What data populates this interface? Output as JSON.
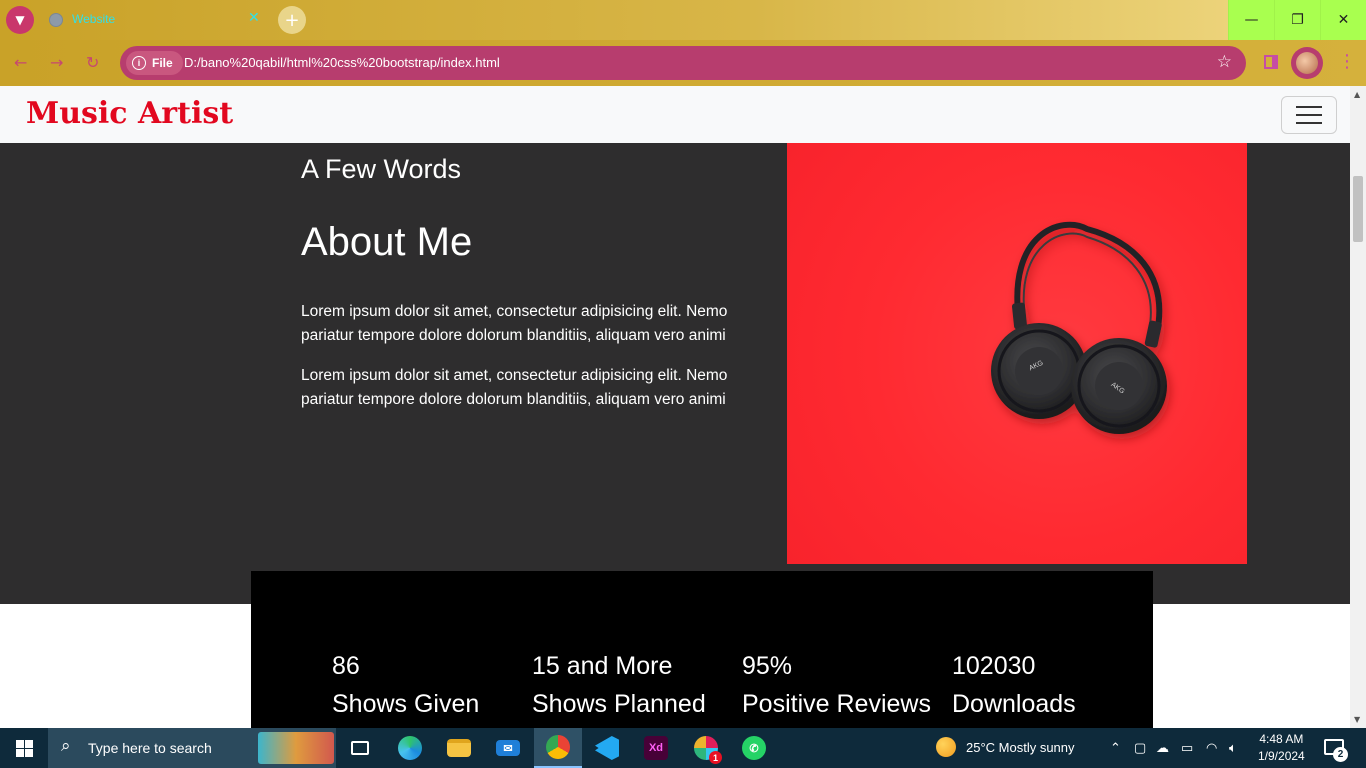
{
  "browser": {
    "tab_title": "Website",
    "tab_close": "✕",
    "new_tab": "+",
    "window_controls": {
      "minimize": "—",
      "restore": "❐",
      "close": "✕"
    },
    "chip_label": "File",
    "url": "D:/bano%20qabil/html%20css%20bootstrap/index.html"
  },
  "navbar": {
    "brand": "Music Artist"
  },
  "about": {
    "eyebrow": "A Few Words",
    "heading": "About Me",
    "paragraphs": [
      "Lorem ipsum dolor sit amet, consectetur adipisicing elit. Nemo pariatur tempore dolore dolorum blanditiis, aliquam vero animi",
      "Lorem ipsum dolor sit amet, consectetur adipisicing elit. Nemo pariatur tempore dolore dolorum blanditiis, aliquam vero animi"
    ],
    "image_brand_text": "AKG"
  },
  "stats": [
    {
      "value": "86",
      "label": "Shows Given"
    },
    {
      "value": "15 and More",
      "label": "Shows Planned"
    },
    {
      "value": "95%",
      "label": "Positive Reviews"
    },
    {
      "value": "102030",
      "label": "Downloads"
    }
  ],
  "taskbar": {
    "search_placeholder": "Type here to search",
    "apps": [
      "task-view",
      "edge",
      "file-explorer",
      "mail",
      "chrome",
      "vscode",
      "adobe-xd",
      "slack",
      "whatsapp"
    ],
    "xd_label": "Xd",
    "slack_badge": "1",
    "weather": "25°C  Mostly sunny",
    "time": "4:48 AM",
    "date": "1/9/2024",
    "notification_count": "2"
  },
  "colors": {
    "brand_red": "#e2081f",
    "image_red": "#ff2b33",
    "section_dark": "#2e2d2e",
    "stats_bg": "#000000"
  }
}
